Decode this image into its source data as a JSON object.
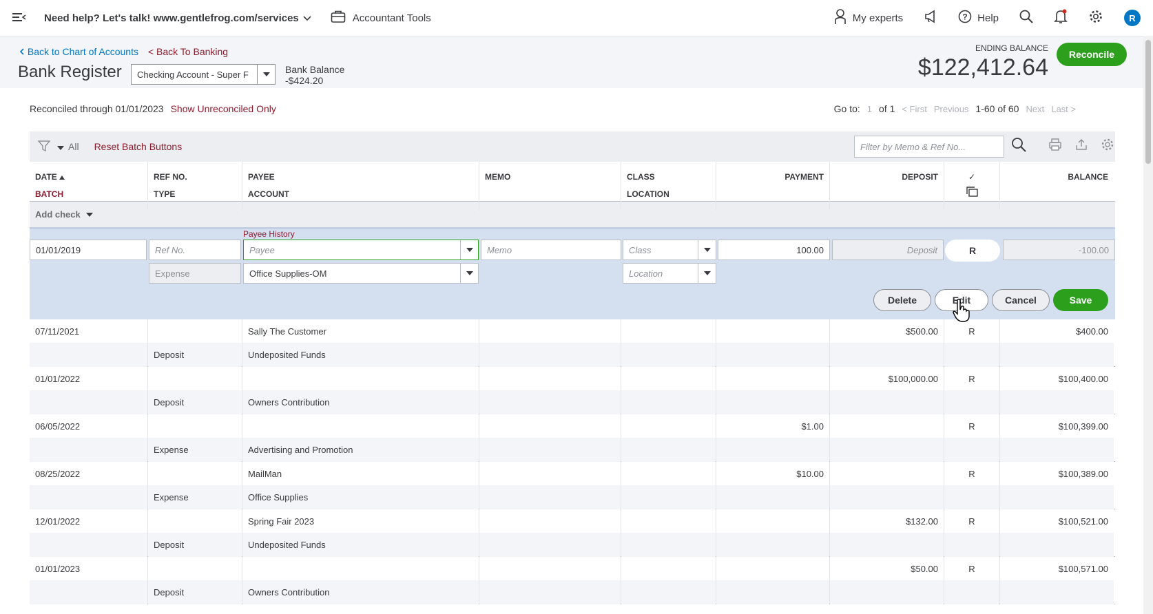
{
  "topbar": {
    "help_text": "Need help? Let's talk! www.gentlefrog.com/services",
    "accountant_tools": "Accountant Tools",
    "my_experts": "My experts",
    "help": "Help",
    "avatar_letter": "R"
  },
  "header": {
    "back_chart": "Back to Chart of Accounts",
    "back_banking": "< Back To Banking",
    "title": "Bank Register",
    "account": "Checking Account - Super F",
    "bank_balance_label": "Bank Balance",
    "bank_balance_value": "-$424.20",
    "ending_balance_label": "ENDING BALANCE",
    "ending_balance_value": "$122,412.64",
    "reconcile": "Reconcile"
  },
  "status": {
    "reconciled": "Reconciled through 01/01/2023",
    "show_unreconciled": "Show Unreconciled Only"
  },
  "pager": {
    "goto": "Go to:",
    "page": "1",
    "of": "of 1",
    "first": "< First",
    "previous": "Previous",
    "range": "1-60 of 60",
    "next": "Next",
    "last": "Last >"
  },
  "toolbar": {
    "all": "All",
    "reset": "Reset Batch Buttons",
    "filter_placeholder": "Filter by Memo & Ref No..."
  },
  "columns": {
    "date": "DATE",
    "batch": "BATCH",
    "ref": "REF NO.",
    "type": "TYPE",
    "payee": "PAYEE",
    "account": "ACCOUNT",
    "memo": "MEMO",
    "class": "CLASS",
    "location": "LOCATION",
    "payment": "PAYMENT",
    "deposit": "DEPOSIT",
    "check": "✓",
    "balance": "BALANCE"
  },
  "add_check": "Add check",
  "edit": {
    "payee_history": "Payee History",
    "date": "01/01/2019",
    "ref_placeholder": "Ref No.",
    "payee_placeholder": "Payee",
    "memo_placeholder": "Memo",
    "class_placeholder": "Class",
    "payment": "100.00",
    "deposit_placeholder": "Deposit",
    "reconcile_status": "R",
    "balance": "-100.00",
    "type": "Expense",
    "account": "Office Supplies-OM",
    "location_placeholder": "Location",
    "delete": "Delete",
    "edit": "Edit",
    "cancel": "Cancel",
    "save": "Save"
  },
  "rows": [
    {
      "date": "07/11/2021",
      "type": "Deposit",
      "payee": "Sally The Customer",
      "account": "Undeposited Funds",
      "payment": "",
      "deposit": "$500.00",
      "status": "R",
      "balance": "$400.00"
    },
    {
      "date": "01/01/2022",
      "type": "Deposit",
      "payee": "",
      "account": "Owners Contribution",
      "payment": "",
      "deposit": "$100,000.00",
      "status": "R",
      "balance": "$100,400.00"
    },
    {
      "date": "06/05/2022",
      "type": "Expense",
      "payee": "",
      "account": "Advertising and Promotion",
      "payment": "$1.00",
      "deposit": "",
      "status": "R",
      "balance": "$100,399.00"
    },
    {
      "date": "08/25/2022",
      "type": "Expense",
      "payee": "MailMan",
      "account": "Office Supplies",
      "payment": "$10.00",
      "deposit": "",
      "status": "R",
      "balance": "$100,389.00"
    },
    {
      "date": "12/01/2022",
      "type": "Deposit",
      "payee": "Spring Fair 2023",
      "account": "Undeposited Funds",
      "payment": "",
      "deposit": "$132.00",
      "status": "R",
      "balance": "$100,521.00"
    },
    {
      "date": "01/01/2023",
      "type": "Deposit",
      "payee": "",
      "account": "Owners Contribution",
      "payment": "",
      "deposit": "$50.00",
      "status": "R",
      "balance": "$100,571.00"
    }
  ]
}
